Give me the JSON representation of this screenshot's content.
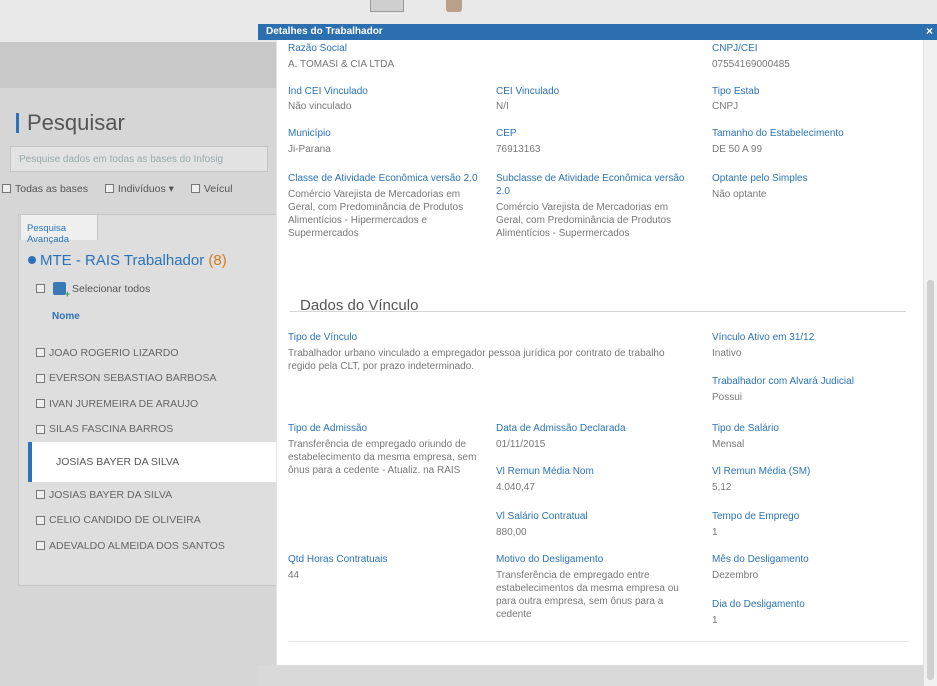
{
  "background": {
    "search_title": "Pesquisar",
    "search_placeholder": "Pesquise dados em todas as bases do Infosig",
    "filters": [
      "Todas as bases",
      "Indivíduos ▾",
      "Veícul"
    ],
    "advanced_tab": "Pesquisa Avançada",
    "section_title": "MTE - RAIS Trabalhador",
    "section_count": "(8)",
    "select_all": "Selecionar todos",
    "name_header": "Nome",
    "names": [
      "JOAO ROGERIO LIZARDO",
      "EVERSON SEBASTIAO BARBOSA",
      "IVAN JUREMEIRA DE ARAUJO",
      "SILAS FASCINA BARROS",
      "JOSIAS BAYER DA SILVA",
      "JOSIAS BAYER DA SILVA",
      "CELIO CANDIDO DE OLIVEIRA",
      "ADEVALDO ALMEIDA DOS SANTOS"
    ]
  },
  "modal": {
    "title": "Detalhes do Trabalhador",
    "close": "×",
    "razao_social": {
      "label": "Razão Social",
      "value": "A. TOMASI & CIA LTDA"
    },
    "cnpj_cei": {
      "label": "CNPJ/CEI",
      "value": "07554169000485"
    },
    "ind_cei": {
      "label": "Ind CEI Vinculado",
      "value": "Não vinculado"
    },
    "cei_vinculado": {
      "label": "CEI Vinculado",
      "value": "N/I"
    },
    "tipo_estab": {
      "label": "Tipo Estab",
      "value": "CNPJ"
    },
    "municipio": {
      "label": "Município",
      "value": "Ji-Parana"
    },
    "cep": {
      "label": "CEP",
      "value": "76913163"
    },
    "tamanho": {
      "label": "Tamanho do Estabelecimento",
      "value": "DE 50 A 99"
    },
    "classe_ativ": {
      "label": "Classe de Atividade Econômica versão 2.0",
      "value": "Comércio Varejista de Mercadorias em Geral, com Predominância de Produtos Alimentícios - Hipermercados e Supermercados"
    },
    "subclasse_ativ": {
      "label": "Subclasse de Atividade Econômica versão 2.0",
      "value": "Comércio Varejista de Mercadorias em Geral, com Predominância de Produtos Alimentícios - Supermercados"
    },
    "optante": {
      "label": "Optante pelo Simples",
      "value": "Não optante"
    },
    "vinculo_section": "Dados do Vínculo",
    "tipo_vinculo": {
      "label": "Tipo de Vínculo",
      "value": "Trabalhador urbano vinculado a empregador pessoa jurídica por contrato de trabalho regido pela CLT, por prazo indeterminado."
    },
    "vinculo_ativo": {
      "label": "Vínculo Ativo em 31/12",
      "value": "Inativo"
    },
    "alvara": {
      "label": "Trabalhador com Alvará Judicial",
      "value": "Possui"
    },
    "tipo_admissao": {
      "label": "Tipo de Admissão",
      "value": "Transferência de empregado oriundo de estabelecimento da mesma empresa, sem ônus para a cedente - Atualiz. na RAIS"
    },
    "data_admissao": {
      "label": "Data de Admissão Declarada",
      "value": "01/11/2015"
    },
    "tipo_salario": {
      "label": "Tipo de Salário",
      "value": "Mensal"
    },
    "remun_nom": {
      "label": "Vl Remun Média Nom",
      "value": "4.040,47"
    },
    "remun_sm": {
      "label": "Vl Remun Média (SM)",
      "value": "5,12"
    },
    "salario_contratual": {
      "label": "Vl Salário Contratual",
      "value": "880,00"
    },
    "tempo_emprego": {
      "label": "Tempo de Emprego",
      "value": "1"
    },
    "horas": {
      "label": "Qtd Horas Contratuais",
      "value": "44"
    },
    "motivo": {
      "label": "Motivo do Desligamento",
      "value": "Transferência de empregado entre estabelecimentos da mesma empresa ou para outra empresa, sem ônus para a cedente"
    },
    "mes_desl": {
      "label": "Mês do Desligamento",
      "value": "Dezembro"
    },
    "dia_desl": {
      "label": "Dia do Desligamento",
      "value": "1"
    }
  }
}
